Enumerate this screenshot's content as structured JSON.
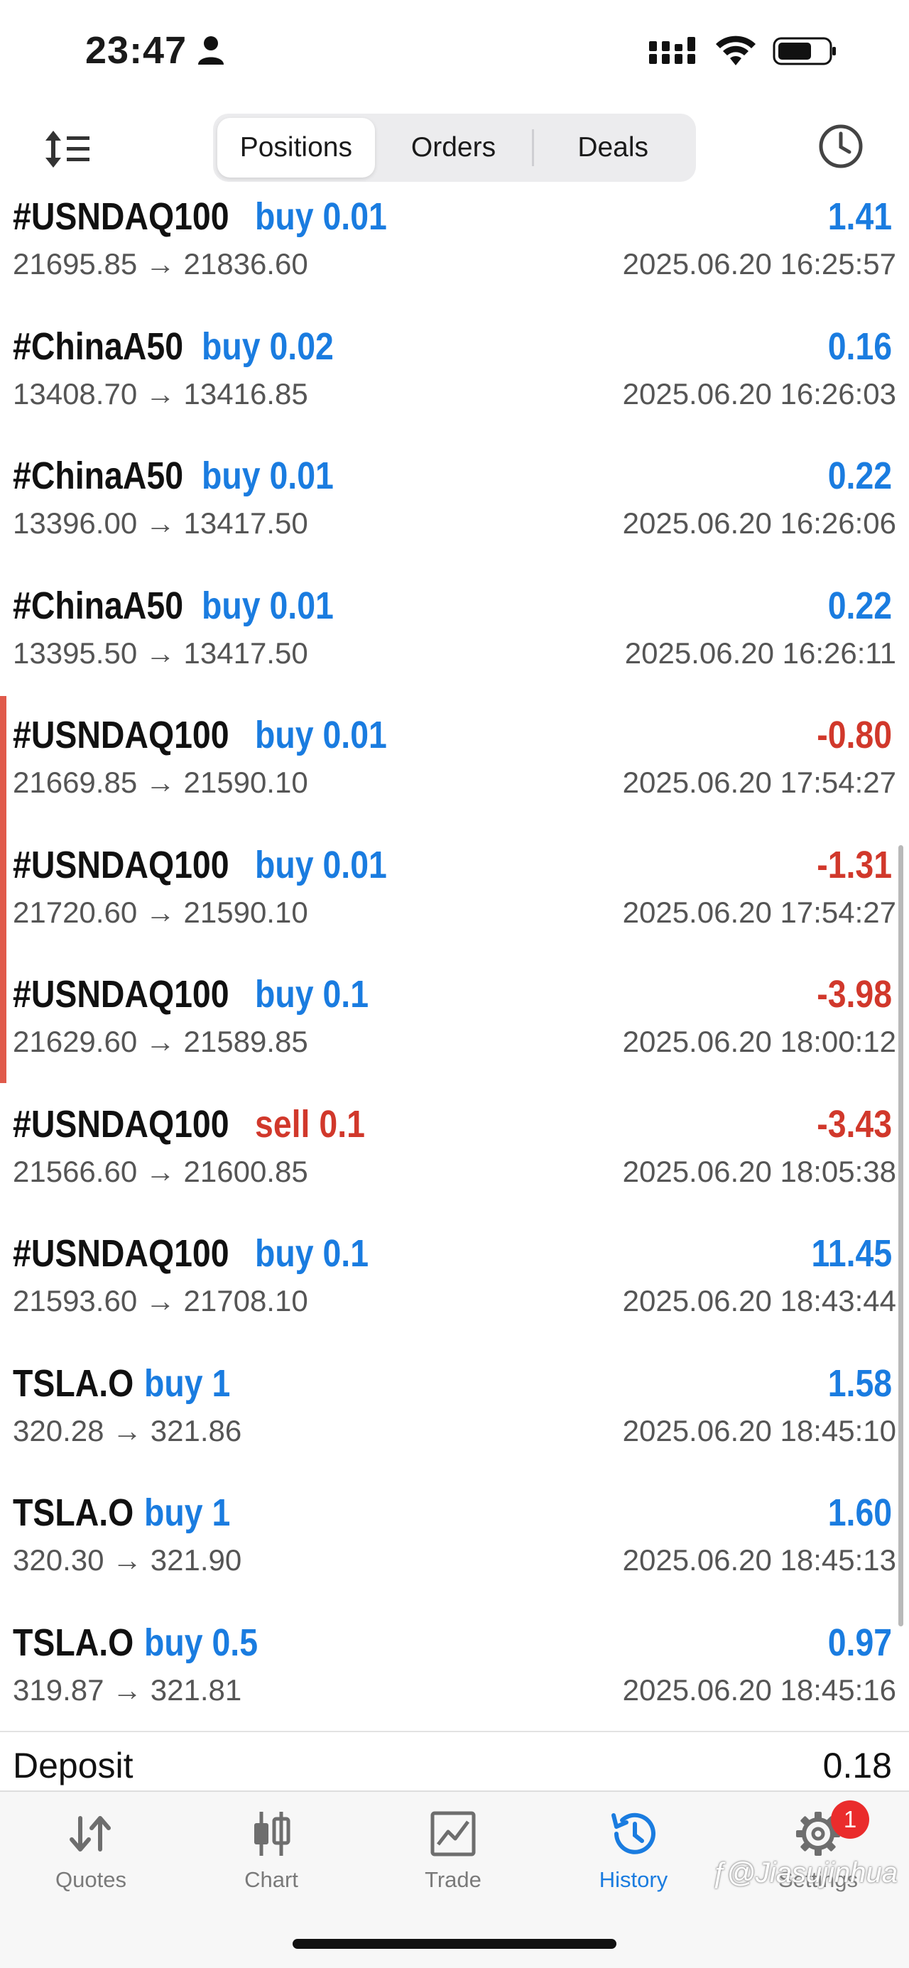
{
  "status_bar": {
    "time": "23:47"
  },
  "toolbar": {
    "segments": [
      "Positions",
      "Orders",
      "Deals"
    ],
    "active_segment": "Positions"
  },
  "trades": [
    {
      "symbol": "#USNDAQ100",
      "side": "buy 0.01",
      "side_color": "#1a7ce0",
      "prices": "21695.85 → 21836.60",
      "profit": "1.41",
      "profit_color": "#1a7ce0",
      "time": "2025.06.20 16:25:57"
    },
    {
      "symbol": "#ChinaA50",
      "side": "buy 0.02",
      "side_color": "#1a7ce0",
      "prices": "13408.70 → 13416.85",
      "profit": "0.16",
      "profit_color": "#1a7ce0",
      "time": "2025.06.20 16:26:03"
    },
    {
      "symbol": "#ChinaA50",
      "side": "buy 0.01",
      "side_color": "#1a7ce0",
      "prices": "13396.00 → 13417.50",
      "profit": "0.22",
      "profit_color": "#1a7ce0",
      "time": "2025.06.20 16:26:06"
    },
    {
      "symbol": "#ChinaA50",
      "side": "buy 0.01",
      "side_color": "#1a7ce0",
      "prices": "13395.50 → 13417.50",
      "profit": "0.22",
      "profit_color": "#1a7ce0",
      "time": "2025.06.20 16:26:11"
    },
    {
      "symbol": "#USNDAQ100",
      "side": "buy 0.01",
      "side_color": "#1a7ce0",
      "prices": "21669.85 → 21590.10",
      "profit": "-0.80",
      "profit_color": "#d1382b",
      "time": "2025.06.20 17:54:27"
    },
    {
      "symbol": "#USNDAQ100",
      "side": "buy 0.01",
      "side_color": "#1a7ce0",
      "prices": "21720.60 → 21590.10",
      "profit": "-1.31",
      "profit_color": "#d1382b",
      "time": "2025.06.20 17:54:27"
    },
    {
      "symbol": "#USNDAQ100",
      "side": "buy 0.1",
      "side_color": "#1a7ce0",
      "prices": "21629.60 → 21589.85",
      "profit": "-3.98",
      "profit_color": "#d1382b",
      "time": "2025.06.20 18:00:12"
    },
    {
      "symbol": "#USNDAQ100",
      "side": "sell 0.1",
      "side_color": "#d1382b",
      "prices": "21566.60 → 21600.85",
      "profit": "-3.43",
      "profit_color": "#d1382b",
      "time": "2025.06.20 18:05:38"
    },
    {
      "symbol": "#USNDAQ100",
      "side": "buy 0.1",
      "side_color": "#1a7ce0",
      "prices": "21593.60 → 21708.10",
      "profit": "11.45",
      "profit_color": "#1a7ce0",
      "time": "2025.06.20 18:43:44"
    },
    {
      "symbol": "TSLA.O",
      "side": "buy 1",
      "side_color": "#1a7ce0",
      "prices": "320.28 → 321.86",
      "profit": "1.58",
      "profit_color": "#1a7ce0",
      "time": "2025.06.20 18:45:10"
    },
    {
      "symbol": "TSLA.O",
      "side": "buy 1",
      "side_color": "#1a7ce0",
      "prices": "320.30 → 321.90",
      "profit": "1.60",
      "profit_color": "#1a7ce0",
      "time": "2025.06.20 18:45:13"
    },
    {
      "symbol": "TSLA.O",
      "side": "buy 0.5",
      "side_color": "#1a7ce0",
      "prices": "319.87 → 321.81",
      "profit": "0.97",
      "profit_color": "#1a7ce0",
      "time": "2025.06.20 18:45:16"
    }
  ],
  "deposit": {
    "label": "Deposit",
    "value": "0.18"
  },
  "tabbar": {
    "items": [
      {
        "label": "Quotes",
        "icon": "quotes-arrows-icon"
      },
      {
        "label": "Chart",
        "icon": "candlestick-icon"
      },
      {
        "label": "Trade",
        "icon": "trade-chart-icon"
      },
      {
        "label": "History",
        "icon": "history-clock-icon"
      },
      {
        "label": "Settings",
        "icon": "gear-icon"
      }
    ],
    "active": "History",
    "settings_badge": "1"
  },
  "watermark": "ƒ@Jiasujinhua",
  "colors": {
    "accent": "#1a7ce0",
    "loss": "#d1382b"
  }
}
